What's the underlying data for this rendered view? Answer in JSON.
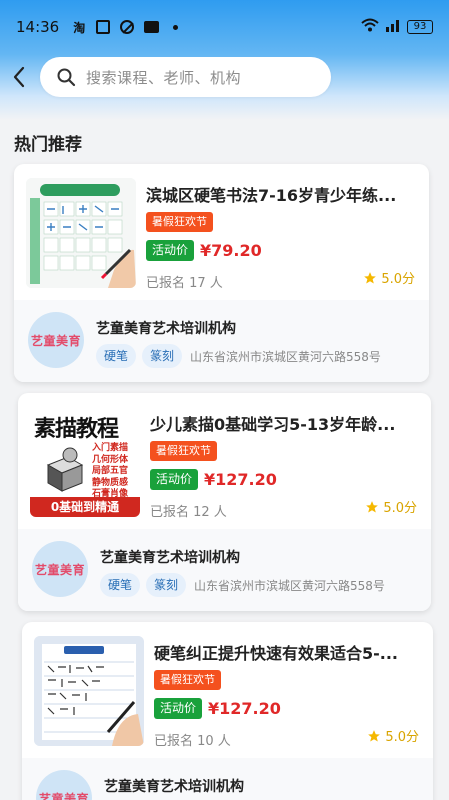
{
  "status_bar": {
    "time": "14:36",
    "taobao_icon_text": "淘",
    "battery": "93"
  },
  "nav": {
    "search_placeholder": "搜索课程、老师、机构"
  },
  "section": {
    "title": "热门推荐"
  },
  "courses": [
    {
      "title": "滨城区硬笔书法7-16岁青少年练...",
      "promo": "暑假狂欢节",
      "activity_label": "活动价",
      "price": "¥79.20",
      "enrolled": "已报名 17 人",
      "rating": "5.0分",
      "org": {
        "logo_text": "艺童美育",
        "name": "艺童美育艺术培训机构",
        "tags": [
          "硬笔",
          "篆刻"
        ],
        "address": "山东省滨州市滨城区黄河六路558号"
      }
    },
    {
      "title": "少儿素描0基础学习5-13岁年龄...",
      "promo": "暑假狂欢节",
      "activity_label": "活动价",
      "price": "¥127.20",
      "enrolled": "已报名 12 人",
      "rating": "5.0分",
      "thumb": {
        "headline": "素描教程",
        "items": [
          "入门素描",
          "几何形体",
          "局部五官",
          "静物质感",
          "石膏肖像"
        ],
        "banner": "0基础到精通"
      },
      "org": {
        "logo_text": "艺童美育",
        "name": "艺童美育艺术培训机构",
        "tags": [
          "硬笔",
          "篆刻"
        ],
        "address": "山东省滨州市滨城区黄河六路558号"
      }
    },
    {
      "title": "硬笔纠正提升快速有效果适合5-...",
      "promo": "暑假狂欢节",
      "activity_label": "活动价",
      "price": "¥127.20",
      "enrolled": "已报名 10 人",
      "rating": "5.0分",
      "org": {
        "logo_text": "艺童美育",
        "name": "艺童美育艺术培训机构"
      }
    }
  ],
  "colors": {
    "promo": "#f4511e",
    "activity": "#19a13b",
    "price": "#e02828",
    "star": "#f5b800",
    "chip_bg": "#e6f0fb",
    "header_gradient_top": "#2f9cf0"
  }
}
